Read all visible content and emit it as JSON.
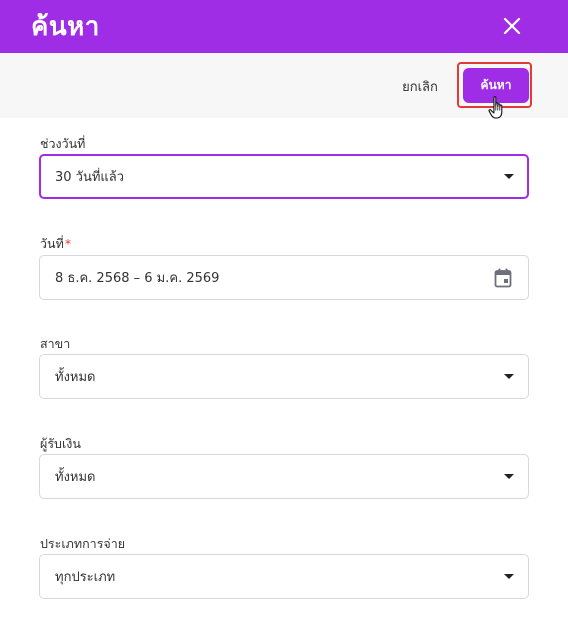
{
  "header": {
    "title": "ค้นหา",
    "close_icon": "close-icon"
  },
  "toolbar": {
    "cancel_label": "ยกเลิก",
    "search_label": "ค้นหา"
  },
  "form": {
    "date_range": {
      "label": "ช่วงวันที่",
      "value": "30 วันที่แล้ว",
      "icon": "chevron-down-icon"
    },
    "date": {
      "label": "วันที่",
      "required_mark": "*",
      "value": "8 ธ.ค. 2568 – 6 ม.ค. 2569",
      "icon": "calendar-icon"
    },
    "branch": {
      "label": "สาขา",
      "value": "ทั้งหมด",
      "icon": "chevron-down-icon"
    },
    "payee": {
      "label": "ผู้รับเงิน",
      "value": "ทั้งหมด",
      "icon": "chevron-down-icon"
    },
    "expense_type": {
      "label": "ประเภทการจ่าย",
      "value": "ทุกประเภท",
      "icon": "chevron-down-icon"
    }
  },
  "colors": {
    "accent": "#a02de6",
    "highlight": "#e53935",
    "toolbar_bg": "#f7f7f8",
    "border": "#d7d7de"
  }
}
